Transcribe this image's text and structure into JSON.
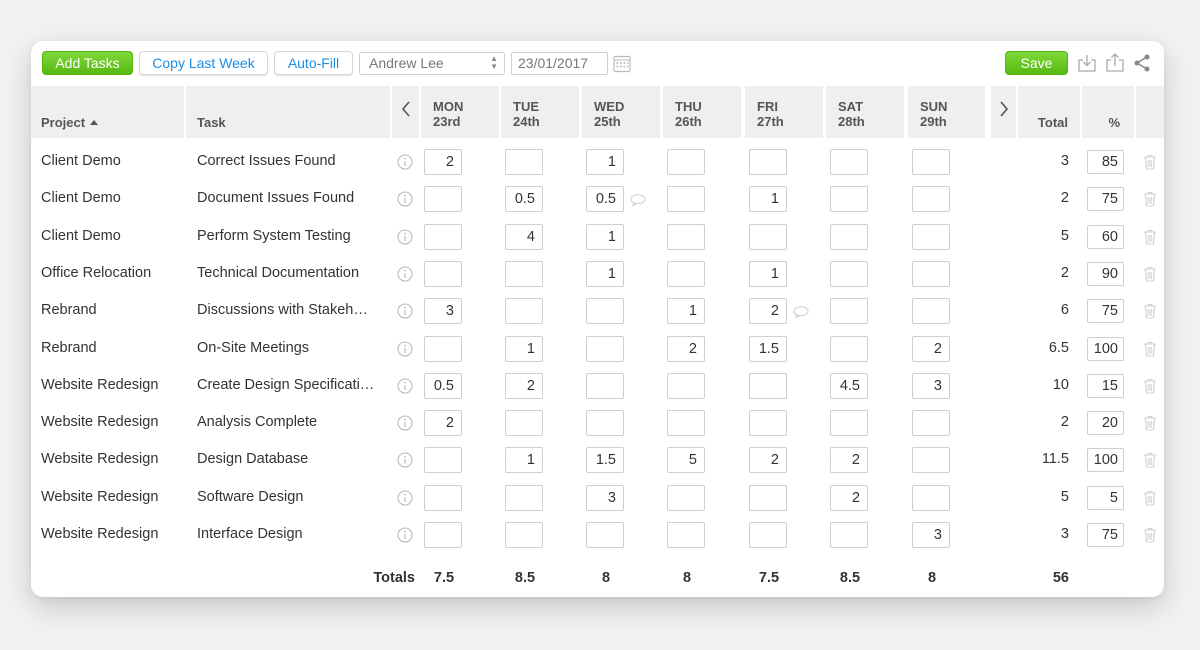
{
  "toolbar": {
    "add_tasks": "Add Tasks",
    "copy_last_week": "Copy Last Week",
    "auto_fill": "Auto-Fill",
    "user_select": "Andrew Lee",
    "date": "23/01/2017",
    "save": "Save",
    "icons": [
      "calendar-icon",
      "download-icon",
      "upload-icon",
      "share-icon"
    ]
  },
  "header": {
    "project": "Project",
    "task": "Task",
    "prev": "‹",
    "next": "›",
    "days": [
      {
        "name": "MON",
        "date": "23rd"
      },
      {
        "name": "TUE",
        "date": "24th"
      },
      {
        "name": "WED",
        "date": "25th"
      },
      {
        "name": "THU",
        "date": "26th"
      },
      {
        "name": "FRI",
        "date": "27th"
      },
      {
        "name": "SAT",
        "date": "28th"
      },
      {
        "name": "SUN",
        "date": "29th"
      }
    ],
    "total": "Total",
    "percent": "%"
  },
  "rows": [
    {
      "project": "Client Demo",
      "task": "Correct Issues Found",
      "hours": [
        "2",
        "",
        "1",
        "",
        "",
        "",
        ""
      ],
      "total": "3",
      "percent": "85"
    },
    {
      "project": "Client Demo",
      "task": "Document Issues Found",
      "hours": [
        "",
        "0.5",
        "0.5",
        "",
        "1",
        "",
        ""
      ],
      "total": "2",
      "percent": "75",
      "comment_day": 2
    },
    {
      "project": "Client Demo",
      "task": "Perform System Testing",
      "hours": [
        "",
        "4",
        "1",
        "",
        "",
        "",
        ""
      ],
      "total": "5",
      "percent": "60"
    },
    {
      "project": "Office Relocation",
      "task": "Technical Documentation",
      "hours": [
        "",
        "",
        "1",
        "",
        "1",
        "",
        ""
      ],
      "total": "2",
      "percent": "90"
    },
    {
      "project": "Rebrand",
      "task": "Discussions with Stakeh…",
      "hours": [
        "3",
        "",
        "",
        "1",
        "2",
        "",
        ""
      ],
      "total": "6",
      "percent": "75",
      "comment_day": 4
    },
    {
      "project": "Rebrand",
      "task": "On-Site Meetings",
      "hours": [
        "",
        "1",
        "",
        "2",
        "1.5",
        "",
        "2"
      ],
      "total": "6.5",
      "percent": "100"
    },
    {
      "project": "Website Redesign",
      "task": "Create Design Specificati…",
      "hours": [
        "0.5",
        "2",
        "",
        "",
        "",
        "4.5",
        "3"
      ],
      "total": "10",
      "percent": "15"
    },
    {
      "project": "Website Redesign",
      "task": "Analysis Complete",
      "hours": [
        "2",
        "",
        "",
        "",
        "",
        "",
        ""
      ],
      "total": "2",
      "percent": "20"
    },
    {
      "project": "Website Redesign",
      "task": "Design Database",
      "hours": [
        "",
        "1",
        "1.5",
        "5",
        "2",
        "2",
        ""
      ],
      "total": "11.5",
      "percent": "100"
    },
    {
      "project": "Website Redesign",
      "task": "Software Design",
      "hours": [
        "",
        "",
        "3",
        "",
        "",
        "2",
        ""
      ],
      "total": "5",
      "percent": "5"
    },
    {
      "project": "Website Redesign",
      "task": "Interface Design",
      "hours": [
        "",
        "",
        "",
        "",
        "",
        "",
        "3"
      ],
      "total": "3",
      "percent": "75"
    }
  ],
  "totals": {
    "label": "Totals",
    "days": [
      "7.5",
      "8.5",
      "8",
      "8",
      "7.5",
      "8.5",
      "8"
    ],
    "grand": "56"
  },
  "colors": {
    "accent_green": "#6cc726",
    "link_blue": "#1a8fe6",
    "header_bg": "#efefef"
  }
}
